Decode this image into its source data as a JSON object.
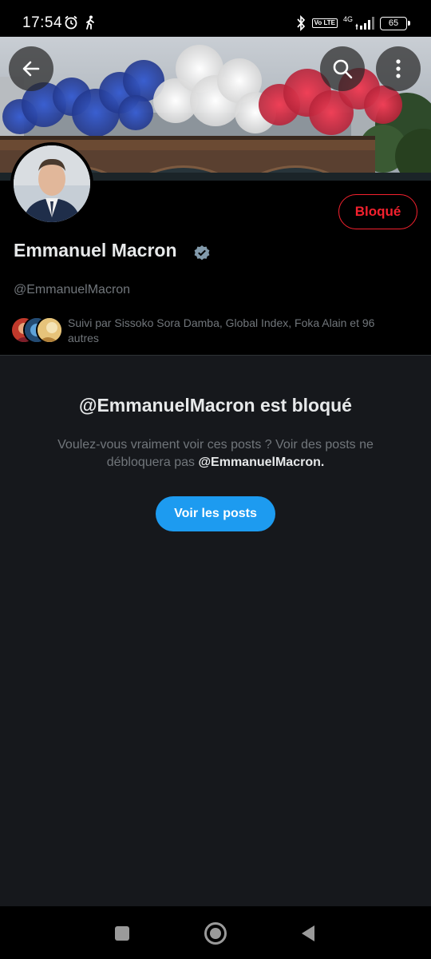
{
  "status_bar": {
    "time": "17:54",
    "network": "4G",
    "volte": "Vo LTE",
    "battery": "65"
  },
  "banner": {
    "image": "flag-colored-smoke-over-paris-bridge",
    "smoke_colors": [
      "#2f4fb4",
      "#eeeeee",
      "#e03347"
    ]
  },
  "profile": {
    "display_name": "Emmanuel Macron",
    "handle": "@EmmanuelMacron",
    "verified": true,
    "followed_by": "Suivi par Sissoko Sora Damba, Global Index, Foka Alain et 96 autres",
    "blocked_label": "Bloqué"
  },
  "blocked": {
    "title": "@EmmanuelMacron est bloqué",
    "desc_prefix": "Voulez-vous vraiment voir ces posts ? Voir des posts ne débloquera pas ",
    "desc_handle": "@EmmanuelMacron.",
    "button_label": "Voir les posts"
  },
  "colors": {
    "accent": "#1d9bf0",
    "blocked_red": "#f4212e",
    "panel_bg": "#16181c"
  }
}
